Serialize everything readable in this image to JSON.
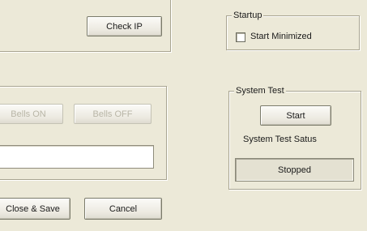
{
  "network": {
    "check_ip_label": "Check IP"
  },
  "startup": {
    "title": "Startup",
    "start_minimized_label": "Start Minimized",
    "start_minimized_checked": false
  },
  "bells": {
    "bells_on_label": "Bells ON",
    "bells_off_label": "Bells OFF",
    "status_value": ""
  },
  "system_test": {
    "title": "System Test",
    "start_label": "Start",
    "status_label": "System Test Satus",
    "status_value": "Stopped"
  },
  "footer": {
    "close_save_label": "Close & Save",
    "cancel_label": "Cancel"
  }
}
